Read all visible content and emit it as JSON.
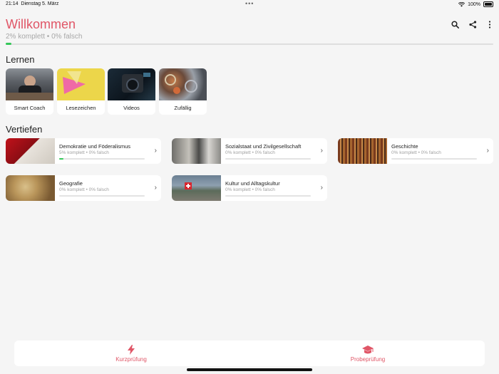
{
  "status": {
    "time": "21:14",
    "date": "Dienstag 5. März",
    "battery": "100%",
    "dots": "•••"
  },
  "header": {
    "title": "Willkommen",
    "subtitle": "2% komplett • 0% falsch",
    "progress": 0.02,
    "icons": [
      "search-icon",
      "share-icon",
      "more-vertical-icon"
    ]
  },
  "learn": {
    "title": "Lernen",
    "tiles": [
      {
        "label": "Smart Coach",
        "image": "person-at-desk"
      },
      {
        "label": "Lesezeichen",
        "image": "bookmark-yellow"
      },
      {
        "label": "Videos",
        "image": "video-camera"
      },
      {
        "label": "Zufällig",
        "image": "random-objects"
      }
    ]
  },
  "deepen": {
    "title": "Vertiefen",
    "topics": [
      {
        "title": "Demokratie und Föderalismus",
        "stats": "5% komplett • 0% falsch",
        "progress": 0.05
      },
      {
        "title": "Sozialstaat und Zivilgesellschaft",
        "stats": "0% komplett • 0% falsch",
        "progress": 0
      },
      {
        "title": "Geschichte",
        "stats": "0% komplett • 0% falsch",
        "progress": 0
      },
      {
        "title": "Geografie",
        "stats": "0% komplett • 0% falsch",
        "progress": 0
      },
      {
        "title": "Kultur und Alltagskultur",
        "stats": "0% komplett • 0% falsch",
        "progress": 0
      }
    ]
  },
  "bottom": {
    "quick": {
      "label": "Kurzprüfung",
      "icon": "lightning-icon"
    },
    "exam": {
      "label": "Probeprüfung",
      "icon": "graduation-cap-icon"
    }
  },
  "colors": {
    "accent": "#e05667",
    "progress": "#34c759"
  }
}
